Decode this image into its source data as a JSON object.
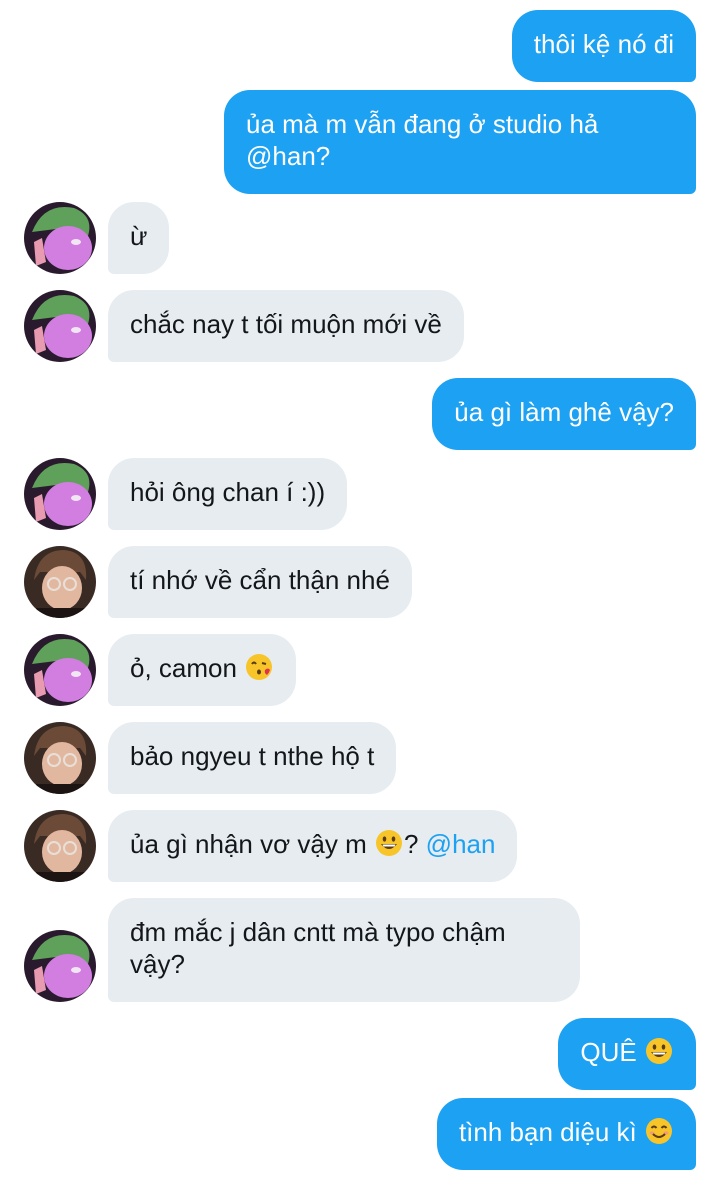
{
  "messages": [
    {
      "text": "thôi kệ nó đi"
    },
    {
      "text": "ủa mà m vẫn đang ở studio hả @han?"
    },
    {
      "text": "ừ"
    },
    {
      "text": "chắc nay t tối muộn mới về"
    },
    {
      "text": "ủa gì làm ghê vậy?"
    },
    {
      "text": "hỏi ông chan í :))"
    },
    {
      "text": "tí nhớ về cẩn thận nhé"
    },
    {
      "text": "ỏ, camon",
      "emoji": "face-blowing-kiss-emoji"
    },
    {
      "text": "bảo ngyeu t nthe hộ t"
    },
    {
      "text_before": "ủa gì nhận vơ vậy m",
      "emoji": "grinning-face-emoji",
      "text_after": "?",
      "mention": "@han"
    },
    {
      "text": "đm mắc j dân cntt mà typo chậm vậy?"
    },
    {
      "text": "QUÊ",
      "emoji": "grinning-face-emoji"
    },
    {
      "text": "tình bạn diệu kì",
      "emoji": "smiling-face-emoji"
    }
  ],
  "colors": {
    "outgoing_bubble": "#1da1f2",
    "incoming_bubble": "#e6ecf0",
    "mention": "#1da1f2"
  }
}
